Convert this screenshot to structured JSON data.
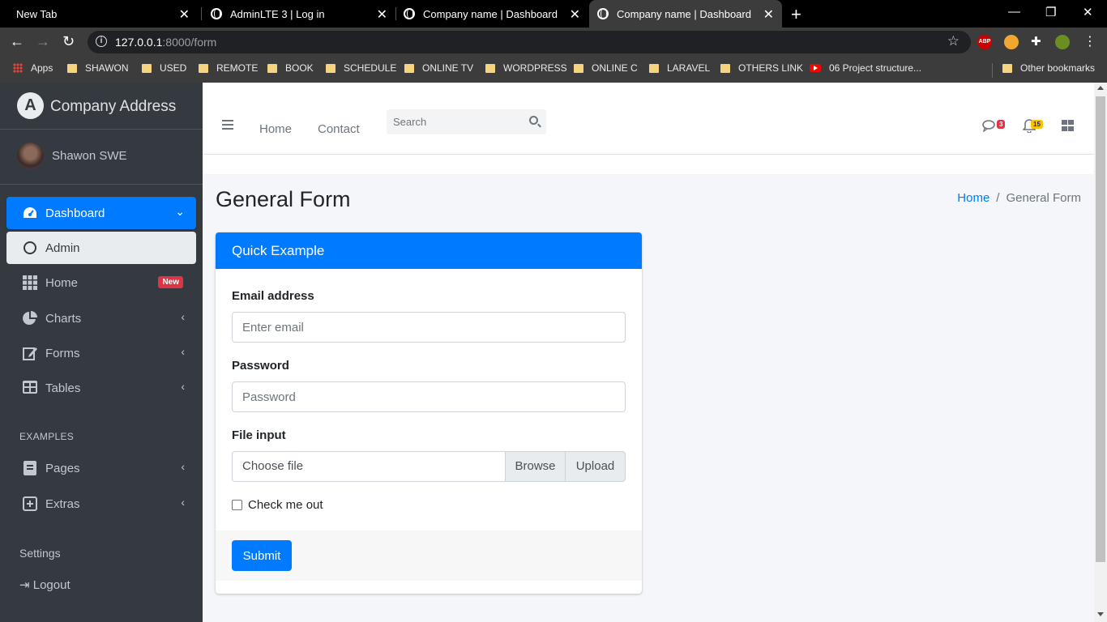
{
  "browser": {
    "tabs": [
      {
        "title": "New Tab"
      },
      {
        "title": "AdminLTE 3 | Log in"
      },
      {
        "title": "Company name | Dashboard"
      },
      {
        "title": "Company name | Dashboard"
      }
    ],
    "url_host": "127.0.0.1",
    "url_rest": ":8000/form",
    "bookmarks": [
      "Apps",
      "SHAWON",
      "USED",
      "REMOTE",
      "BOOK",
      "SCHEDULE",
      "ONLINE TV",
      "WORDPRESS",
      "ONLINE C",
      "LARAVEL",
      "OTHERS LINK",
      "06 Project structure...",
      "Other bookmarks"
    ],
    "extensions": {
      "abp": "ABP"
    }
  },
  "sidebar": {
    "brand": "Company Address",
    "user": "Shawon SWE",
    "items": [
      {
        "label": "Dashboard",
        "icon": "tachometer-icon"
      },
      {
        "label": "Admin",
        "icon": "circle-icon"
      },
      {
        "label": "Home",
        "icon": "grid-icon",
        "badge": "New"
      },
      {
        "label": "Charts",
        "icon": "pie-chart-icon"
      },
      {
        "label": "Forms",
        "icon": "edit-icon"
      },
      {
        "label": "Tables",
        "icon": "table-icon"
      }
    ],
    "examples_header": "EXAMPLES",
    "examples": [
      {
        "label": "Pages",
        "icon": "book-icon"
      },
      {
        "label": "Extras",
        "icon": "plus-square-icon"
      }
    ],
    "settings": "Settings",
    "logout": "Logout"
  },
  "topnav": {
    "links": [
      "Home",
      "Contact"
    ],
    "search_placeholder": "Search",
    "messages_badge": "3",
    "notifications_badge": "15"
  },
  "page": {
    "title": "General Form",
    "breadcrumb": [
      "Home",
      "General Form"
    ]
  },
  "form": {
    "card_title": "Quick Example",
    "email_label": "Email address",
    "email_placeholder": "Enter email",
    "password_label": "Password",
    "password_placeholder": "Password",
    "file_label": "File input",
    "file_placeholder": "Choose file",
    "browse_label": "Browse",
    "upload_label": "Upload",
    "checkbox_label": "Check me out",
    "submit_label": "Submit"
  },
  "colors": {
    "primary": "#007bff",
    "sidebar_bg": "#343a40",
    "danger": "#dc3545",
    "warning": "#ffc107"
  }
}
